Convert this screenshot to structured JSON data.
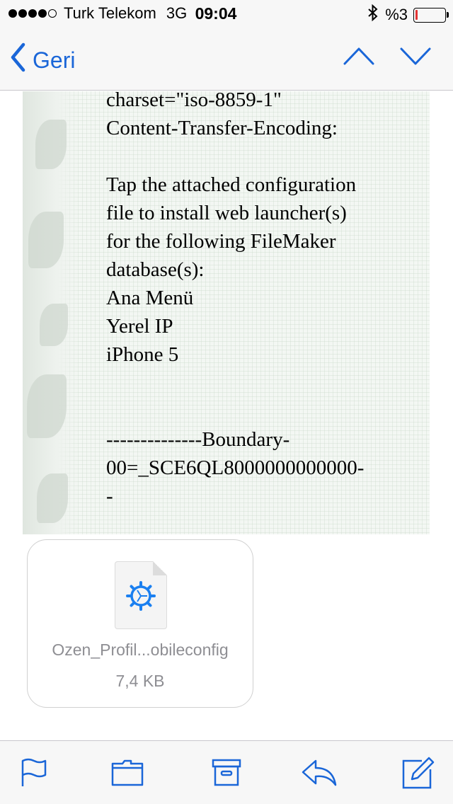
{
  "status_bar": {
    "carrier": "Turk Telekom",
    "network": "3G",
    "time": "09:04",
    "battery_text": "%3",
    "battery_level_percent": 3,
    "signal_bars_filled": 4,
    "signal_bars_total": 5,
    "icons": [
      "bluetooth-icon",
      "battery-icon"
    ]
  },
  "nav": {
    "back_label": "Geri",
    "icons": [
      "chevron-left-icon",
      "chevron-up-icon",
      "chevron-down-icon"
    ]
  },
  "message": {
    "lines": [
      "charset=\"iso-8859-1\"",
      "Content-Transfer-Encoding:",
      "",
      "Tap the attached configuration",
      "file to install web launcher(s)",
      "for the following FileMaker",
      "database(s):",
      "Ana Menü",
      "Yerel IP",
      "iPhone 5",
      "",
      "",
      "--------------Boundary-",
      "00=_SCE6QL8000000000000-",
      "-"
    ]
  },
  "attachment": {
    "filename": "Ozen_Profil...obileconfig",
    "size": "7,4 KB",
    "icon": "gear-icon",
    "accent_color": "#1a7ff0"
  },
  "toolbar": {
    "icons": [
      "flag-icon",
      "folder-icon",
      "archive-icon",
      "reply-icon",
      "compose-icon"
    ]
  },
  "colors": {
    "tint": "#1a66d8",
    "battery_low": "#e33333"
  }
}
